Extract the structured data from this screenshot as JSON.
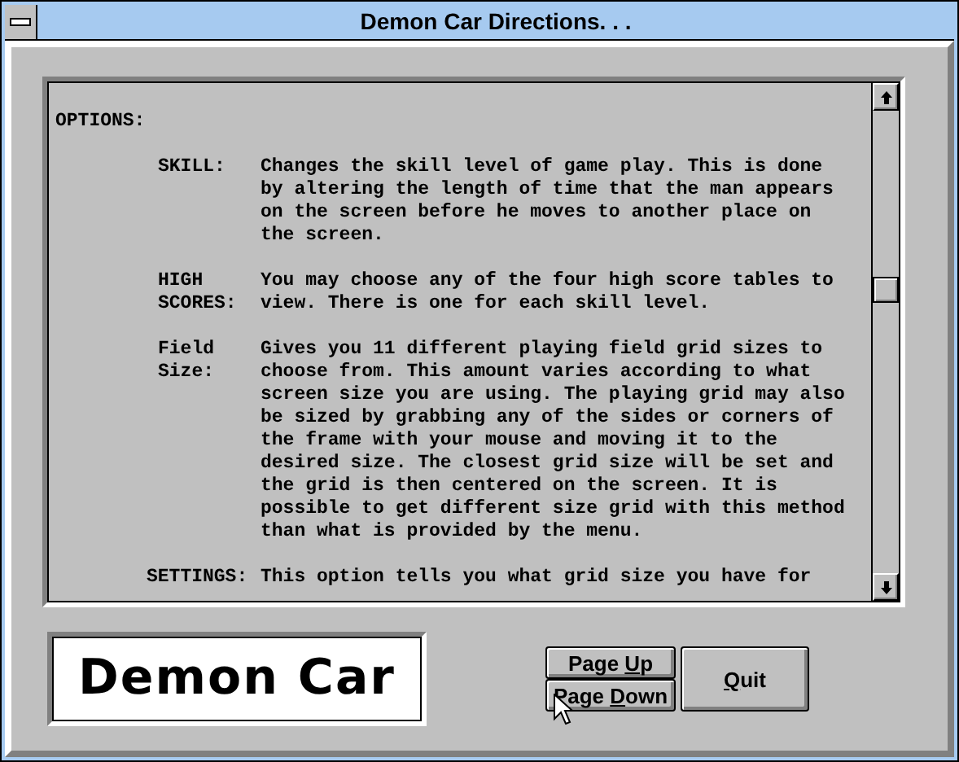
{
  "window": {
    "title": "Demon Car Directions. . ."
  },
  "document": {
    "heading": "OPTIONS:",
    "entries": [
      {
        "label": [
          "SKILL:"
        ],
        "kind": "normal",
        "lines": [
          "Changes the skill level of game play. This is done",
          "by altering the length of time that the man appears",
          "on the screen before he moves to another place on",
          "the screen."
        ]
      },
      {
        "label": [
          "HIGH",
          "SCORES:"
        ],
        "kind": "normal",
        "lines": [
          "You may choose any of the four high score tables to",
          "view. There is one for each skill level."
        ]
      },
      {
        "label": [
          "Field",
          "Size:"
        ],
        "kind": "normal",
        "lines": [
          "Gives you 11 different playing field grid sizes to",
          "choose from. This amount varies according to what",
          "screen size you are using. The playing grid may also",
          "be sized by grabbing any of the sides or corners of",
          "the frame with your mouse and moving it to the",
          "desired size. The closest grid size will be set and",
          "the grid is then centered on the screen. It is",
          "possible to get different size grid with this method",
          "than what is provided by the menu."
        ]
      },
      {
        "label": [
          "SETTINGS:"
        ],
        "kind": "outdent",
        "lines": [
          "This option tells you what grid size you have for"
        ]
      }
    ]
  },
  "logo": {
    "text": "Demon Car"
  },
  "buttons": [
    {
      "before": "Page ",
      "key": "U",
      "after": "p"
    },
    {
      "before": "Page ",
      "key": "D",
      "after": "own"
    },
    {
      "key": "Q",
      "after": "uit"
    }
  ]
}
